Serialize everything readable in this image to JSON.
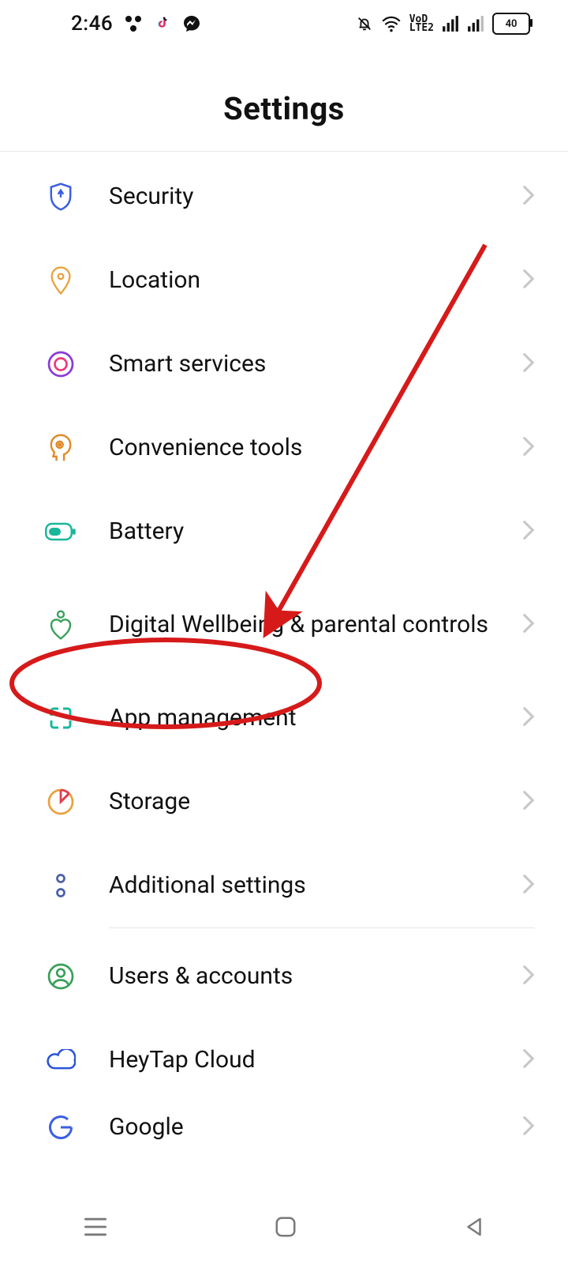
{
  "status_bar": {
    "time": "2:46",
    "battery": "40"
  },
  "title": "Settings",
  "items": [
    {
      "id": "security",
      "label": "Security"
    },
    {
      "id": "location",
      "label": "Location"
    },
    {
      "id": "smart-services",
      "label": "Smart services"
    },
    {
      "id": "convenience-tools",
      "label": "Convenience tools"
    },
    {
      "id": "battery",
      "label": "Battery"
    },
    {
      "id": "digital-wellbeing",
      "label": "Digital Wellbeing & parental controls"
    },
    {
      "id": "app-management",
      "label": "App management"
    },
    {
      "id": "storage",
      "label": "Storage"
    },
    {
      "id": "additional-settings",
      "label": "Additional settings"
    },
    {
      "id": "users-accounts",
      "label": "Users & accounts"
    },
    {
      "id": "heytap-cloud",
      "label": "HeyTap Cloud"
    },
    {
      "id": "google",
      "label": "Google"
    }
  ],
  "annotation": {
    "highlighted_item_id": "app-management",
    "type": "arrow+circle",
    "color": "#d61a1a"
  }
}
